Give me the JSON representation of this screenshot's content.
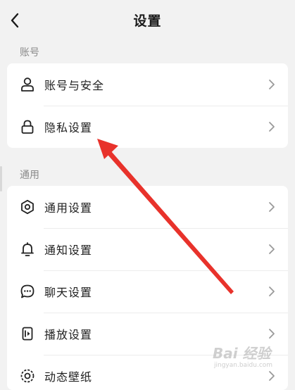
{
  "header": {
    "title": "设置",
    "back_icon": "chevron-left-icon"
  },
  "sections": [
    {
      "label": "账号",
      "items": [
        {
          "label": "账号与安全",
          "icon": "person-icon"
        },
        {
          "label": "隐私设置",
          "icon": "lock-icon"
        }
      ]
    },
    {
      "label": "通用",
      "items": [
        {
          "label": "通用设置",
          "icon": "gear-icon"
        },
        {
          "label": "通知设置",
          "icon": "bell-icon"
        },
        {
          "label": "聊天设置",
          "icon": "chat-bubble-icon"
        },
        {
          "label": "播放设置",
          "icon": "playback-icon"
        },
        {
          "label": "动态壁纸",
          "icon": "live-wallpaper-icon"
        }
      ]
    }
  ],
  "watermark": {
    "brand": "Bai 经验",
    "site": "jingyan.baidu.com"
  },
  "colors": {
    "background": "#f2f2f2",
    "card": "#ffffff",
    "annotation_arrow": "#e8322b"
  }
}
